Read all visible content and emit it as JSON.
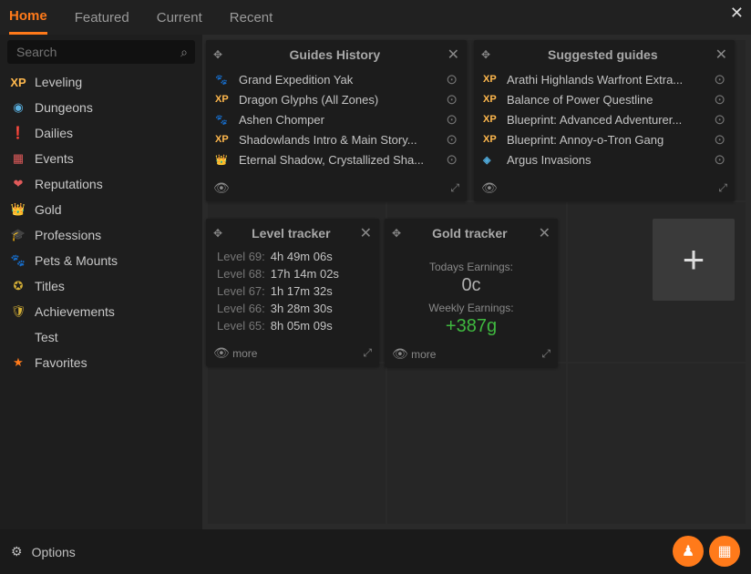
{
  "tabs": {
    "home": "Home",
    "featured": "Featured",
    "current": "Current",
    "recent": "Recent"
  },
  "search": {
    "placeholder": "Search"
  },
  "nav": {
    "leveling": "Leveling",
    "dungeons": "Dungeons",
    "dailies": "Dailies",
    "events": "Events",
    "reputations": "Reputations",
    "gold": "Gold",
    "professions": "Professions",
    "pets": "Pets & Mounts",
    "titles": "Titles",
    "achievements": "Achievements",
    "test": "Test",
    "favorites": "Favorites"
  },
  "options": {
    "label": "Options"
  },
  "widgets": {
    "history": {
      "title": "Guides History",
      "items": [
        {
          "icon": "pet",
          "label": "Grand Expedition Yak"
        },
        {
          "icon": "xp",
          "label": "Dragon Glyphs (All Zones)"
        },
        {
          "icon": "pet",
          "label": "Ashen Chomper"
        },
        {
          "icon": "xp",
          "label": "Shadowlands Intro & Main Story..."
        },
        {
          "icon": "gold",
          "label": "Eternal Shadow, Crystallized Sha..."
        }
      ]
    },
    "suggested": {
      "title": "Suggested guides",
      "items": [
        {
          "icon": "xp",
          "label": "Arathi Highlands Warfront Extra..."
        },
        {
          "icon": "xp",
          "label": "Balance of Power Questline"
        },
        {
          "icon": "xp",
          "label": "Blueprint: Advanced Adventurer..."
        },
        {
          "icon": "xp",
          "label": "Blueprint: Annoy-o-Tron Gang"
        },
        {
          "icon": "rep",
          "label": "Argus Invasions"
        }
      ]
    },
    "level": {
      "title": "Level tracker",
      "rows": [
        {
          "label": "Level 69:",
          "time": "4h 49m 06s"
        },
        {
          "label": "Level 68:",
          "time": "17h 14m 02s"
        },
        {
          "label": "Level 67:",
          "time": "1h 17m 32s"
        },
        {
          "label": "Level 66:",
          "time": "3h 28m 30s"
        },
        {
          "label": "Level 65:",
          "time": "8h 05m 09s"
        }
      ],
      "more": "more"
    },
    "gold": {
      "title": "Gold tracker",
      "today_label": "Todays Earnings:",
      "today_value": "0c",
      "week_label": "Weekly Earnings:",
      "week_value": "+387g",
      "more": "more"
    }
  },
  "icon_text": {
    "xp": "XP",
    "pet": "🐾",
    "gold": "👑",
    "rep": "◈"
  }
}
